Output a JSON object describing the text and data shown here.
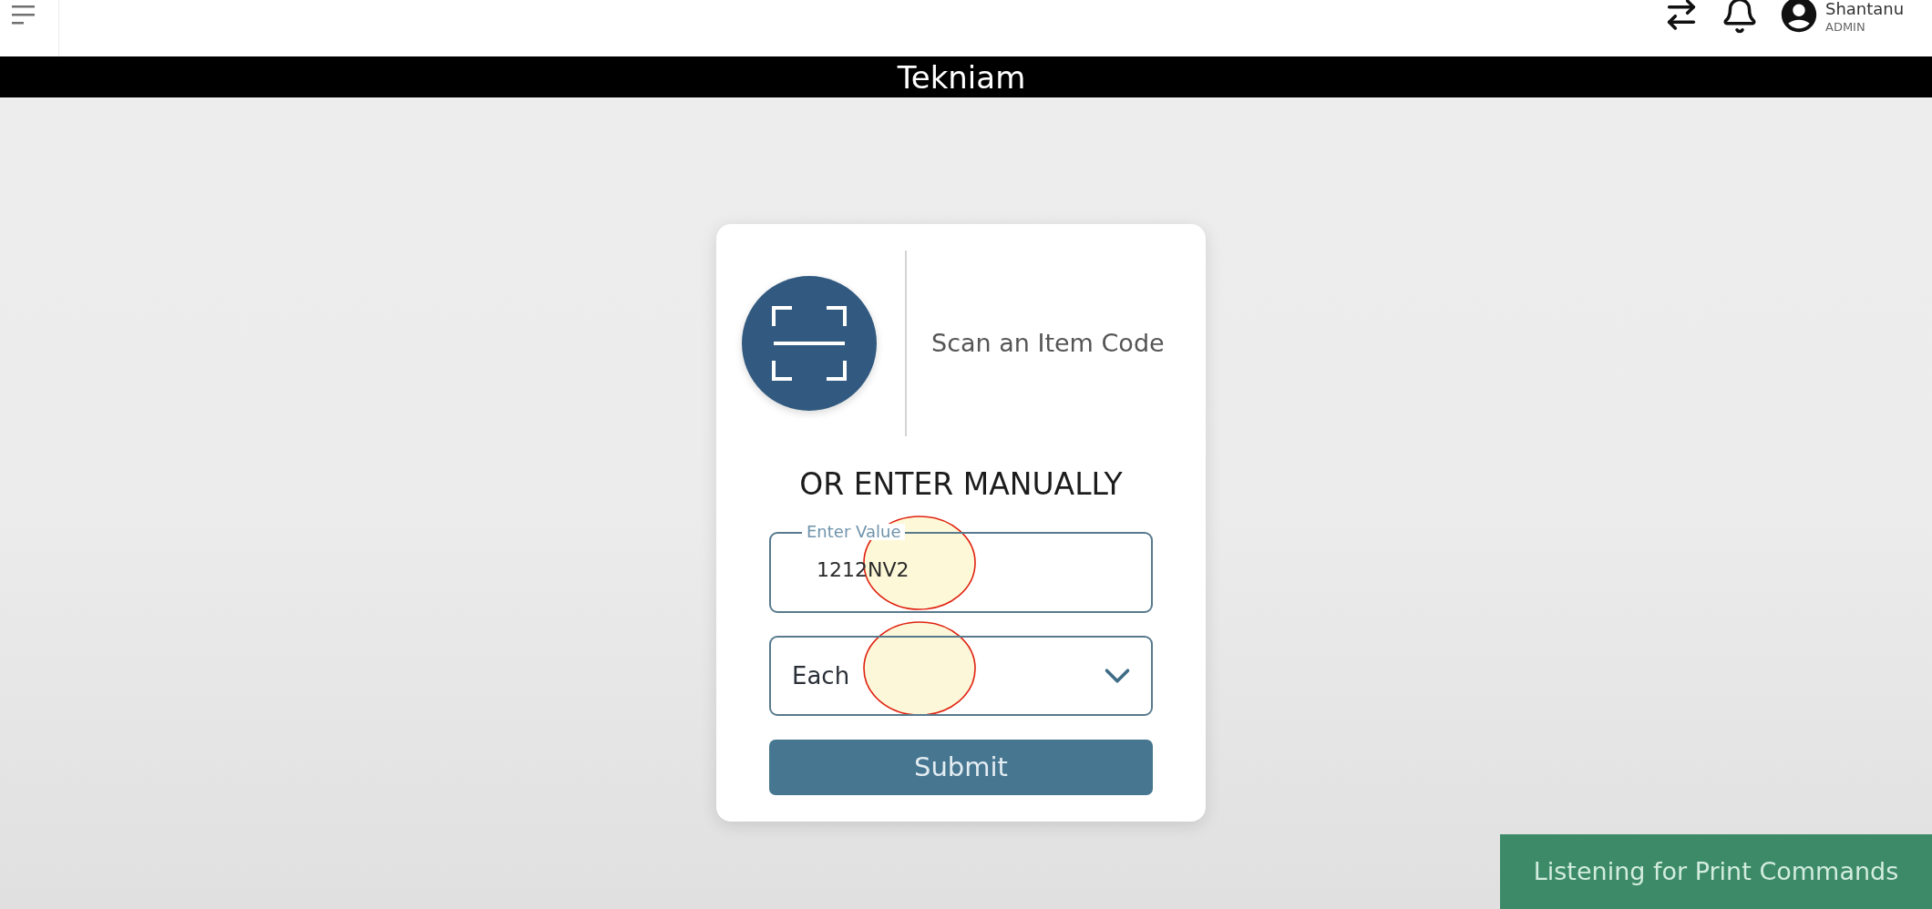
{
  "header": {
    "user": {
      "name": "Shantanu",
      "role": "ADMIN"
    }
  },
  "title_bar": {
    "title": "Tekniam"
  },
  "scan_card": {
    "scan_label": "Scan an Item Code",
    "manual_heading": "OR ENTER MANUALLY",
    "value_field": {
      "label": "Enter Value",
      "value": "1212NV2"
    },
    "unit_select": {
      "value": "Each"
    },
    "submit_button": "Submit"
  },
  "status_toast": {
    "text": "Listening for Print Commands"
  }
}
